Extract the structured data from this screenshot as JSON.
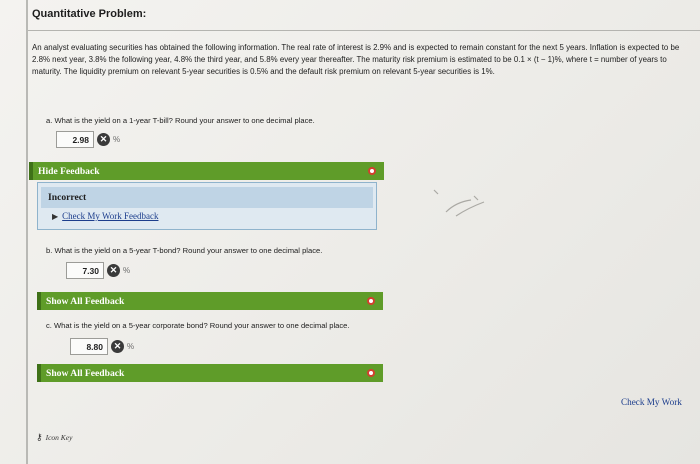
{
  "header": {
    "title": "Quantitative Problem:"
  },
  "problem": {
    "text": "An analyst evaluating securities has obtained the following information. The real rate of interest is 2.9% and is expected to remain constant for the next 5 years. Inflation is expected to be 2.8% next year, 3.8% the following year, 4.8% the third year, and 5.8% every year thereafter. The maturity risk premium is estimated to be 0.1 × (t − 1)%, where t = number of years to maturity. The liquidity premium on relevant 5-year securities is 0.5% and the default risk premium on relevant 5-year securities is 1%."
  },
  "questions": [
    {
      "label": "a. What is the yield on a 1-year T-bill? Round your answer to one decimal place.",
      "answer": "2.98",
      "unit": "%",
      "status_icon": "x-icon",
      "feedback_bar": "Hide Feedback",
      "feedback": {
        "header": "Incorrect",
        "link": "Check My Work Feedback"
      }
    },
    {
      "label": "b. What is the yield on a 5-year T-bond? Round your answer to one decimal place.",
      "answer": "7.30",
      "unit": "%",
      "status_icon": "x-icon",
      "feedback_bar": "Show All Feedback"
    },
    {
      "label": "c. What is the yield on a 5-year corporate bond? Round your answer to one decimal place.",
      "answer": "8.80",
      "unit": "%",
      "status_icon": "x-icon",
      "feedback_bar": "Show All Feedback"
    }
  ],
  "footer": {
    "check_my_work": "Check My Work",
    "icon_key": "Icon Key"
  },
  "colors": {
    "feedback_green": "#5f9c29",
    "panel_blue": "#dfe9f1",
    "link_blue": "#1c3d8c"
  }
}
